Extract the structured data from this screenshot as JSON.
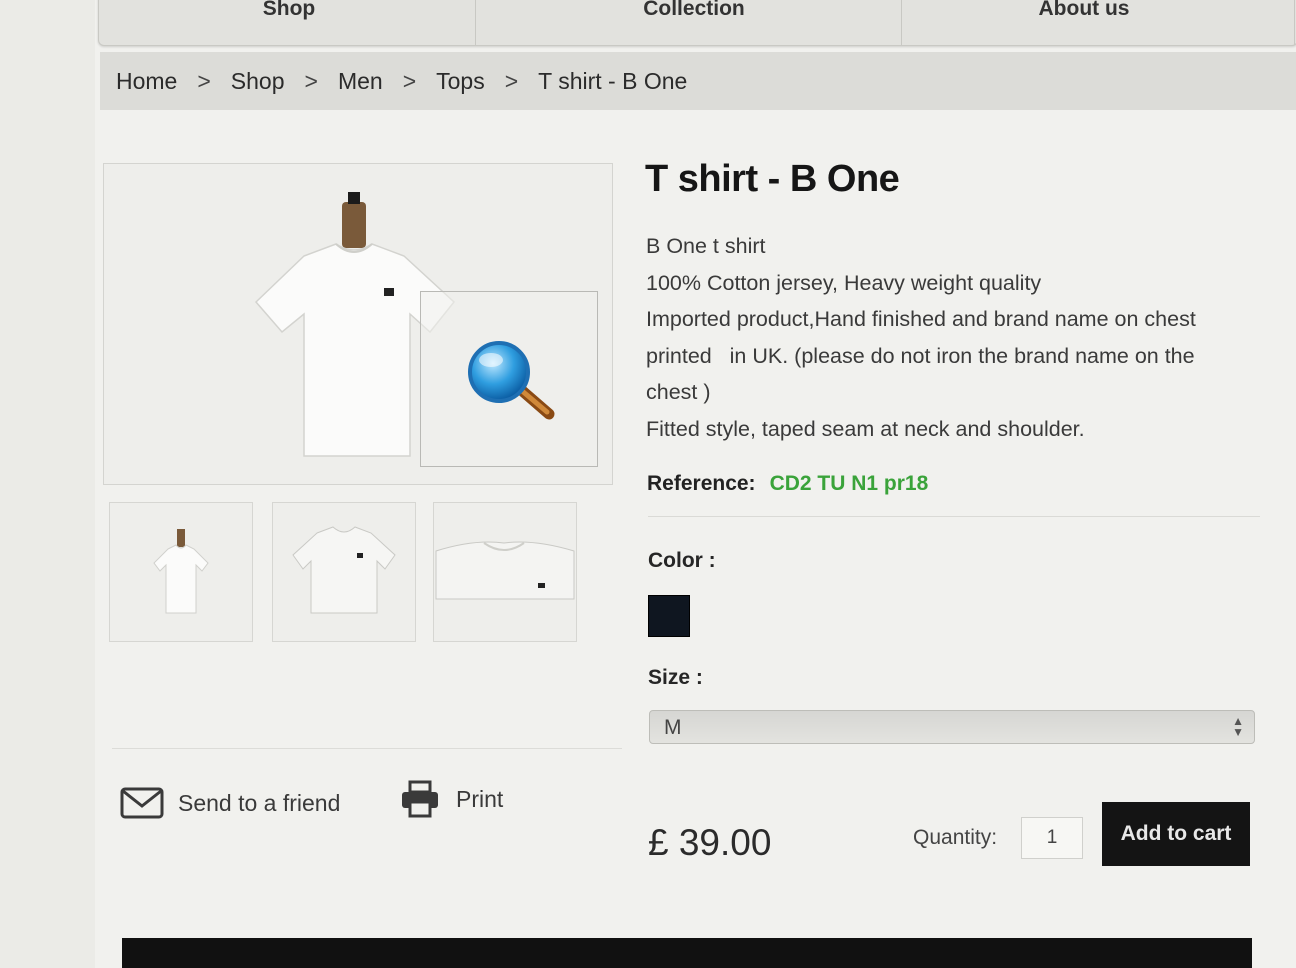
{
  "nav": {
    "items": [
      {
        "label": "Shop"
      },
      {
        "label": "Collection"
      },
      {
        "label": "About us"
      }
    ]
  },
  "breadcrumb": {
    "items": [
      "Home",
      "Shop",
      "Men",
      "Tops"
    ],
    "separator": ">",
    "current": "T shirt - B One"
  },
  "product": {
    "title": "T shirt - B One",
    "description_lines": [
      "B One t shirt",
      "100% Cotton jersey, Heavy weight quality",
      "Imported product,Hand finished and brand name on chest",
      "printed   in UK. (please do not iron the brand name on the",
      "chest )",
      "Fitted style, taped seam at neck and shoulder."
    ],
    "reference_label": "Reference:",
    "reference_value": "CD2 TU N1 pr18",
    "color_label": "Color :",
    "color_swatch": "#0f1620",
    "size_label": "Size :",
    "size_selected": "M",
    "price": "£ 39.00",
    "quantity_label": "Quantity:",
    "quantity_value": "1",
    "add_to_cart_label": "Add to cart"
  },
  "actions": {
    "send_to_friend": "Send to a friend",
    "print": "Print"
  },
  "images": {
    "main_icon": "tshirt-on-mannequin",
    "zoom_icon": "magnifier-icon",
    "thumbnails": [
      "mannequin-front",
      "tshirt-flat",
      "tshirt-folded"
    ]
  },
  "colors": {
    "reference": "#3aa33a",
    "button_bg": "#141414"
  }
}
